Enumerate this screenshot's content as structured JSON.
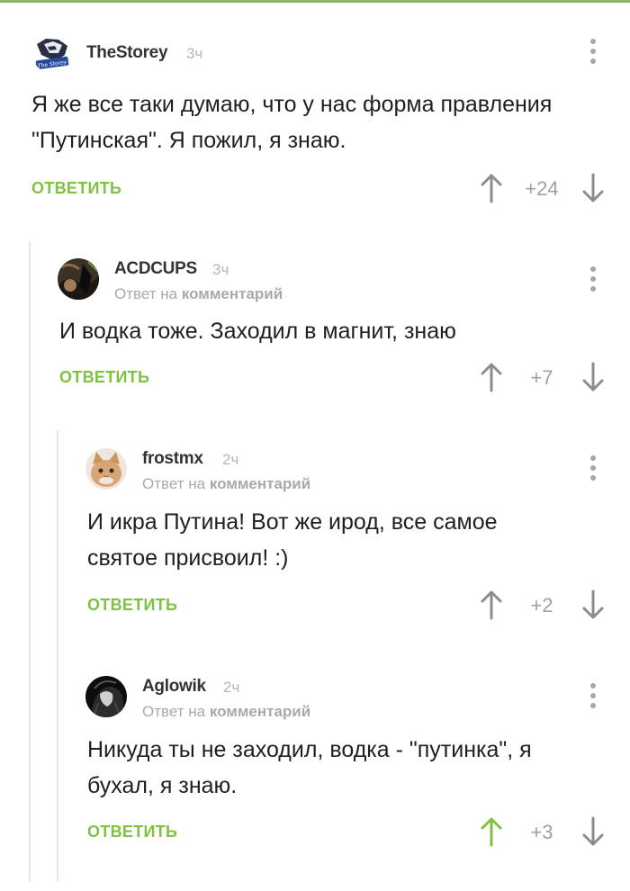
{
  "comments": [
    {
      "author": "TheStorey",
      "time": "3ч",
      "reply_to": null,
      "text_lines": [
        "Я же все таки думаю, что у нас форма правления",
        "\"Путинская\". Я пожил, я знаю."
      ],
      "reply_label": "ОТВЕТИТЬ",
      "rating": "+24",
      "upvoted": false,
      "avatar_caption": "The Storey"
    },
    {
      "author": "ACDCUPS",
      "time": "3ч",
      "reply_to": {
        "prefix": "Ответ на",
        "target": "комментарий"
      },
      "text_lines": [
        "И водка тоже. Заходил в магнит, знаю"
      ],
      "reply_label": "ОТВЕТИТЬ",
      "rating": "+7",
      "upvoted": false
    },
    {
      "author": "frostmx",
      "time": "2ч",
      "reply_to": {
        "prefix": "Ответ на",
        "target": "комментарий"
      },
      "text_lines": [
        "И икра Путина! Вот же ирод, все самое",
        "святое присвоил! :)"
      ],
      "reply_label": "ОТВЕТИТЬ",
      "rating": "+2",
      "upvoted": false
    },
    {
      "author": "Aglowik",
      "time": "2ч",
      "reply_to": {
        "prefix": "Ответ на",
        "target": "комментарий"
      },
      "text_lines": [
        "Никуда ты не заходил, водка - \"путинка\", я",
        "бухал, я знаю."
      ],
      "reply_label": "ОТВЕТИТЬ",
      "rating": "+3",
      "upvoted": true
    }
  ],
  "colors": {
    "accent_green": "#7fc141",
    "arrow_gray": "#8c8c8c",
    "arrow_active": "#7fc141",
    "meta_gray": "#a9a9a9",
    "thread_line": "#e6e6e6"
  },
  "icons": {
    "vote_up": "arrow-up-icon",
    "vote_down": "arrow-down-icon",
    "menu": "more-vertical-icon"
  }
}
